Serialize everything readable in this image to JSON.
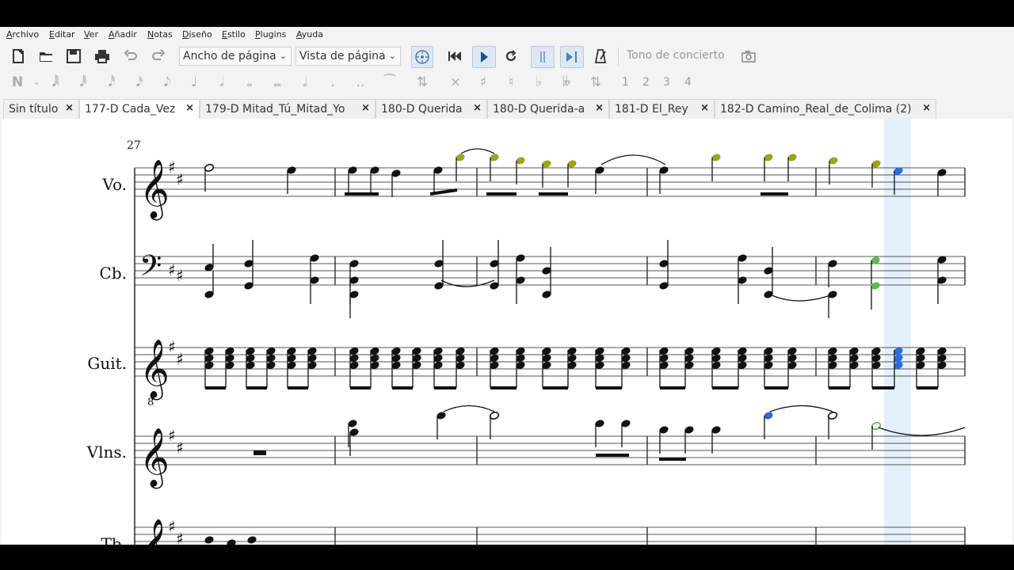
{
  "menu": [
    "Archivo",
    "Editar",
    "Ver",
    "Añadir",
    "Notas",
    "Diseño",
    "Estilo",
    "Plugins",
    "Ayuda"
  ],
  "toolbar": {
    "icons": [
      "new-file-icon",
      "open-folder-icon",
      "save-icon",
      "print-icon",
      "undo-icon",
      "redo-icon"
    ],
    "zoom_select": "Ancho de página",
    "view_select": "Vista de página",
    "playback_icons": [
      "mixer-icon",
      "rewind-icon",
      "play-icon",
      "loop-icon",
      "loop-in-icon",
      "loop-out-icon",
      "metronome-icon"
    ],
    "concert_pitch": "Tono de concierto",
    "camera_icon": "camera-icon"
  },
  "note_input": {
    "durations": [
      "𝅘𝅥𝅲",
      "𝅘𝅥𝅱",
      "𝅘𝅥𝅰",
      "𝅘𝅥𝅯",
      "𝅘𝅥𝅮",
      "♩",
      "𝅗𝅥",
      "𝅝",
      "𝅜",
      "𝅗𝅥"
    ],
    "dots": [
      ".",
      ".."
    ],
    "accidentals": [
      "×",
      "♯",
      "♮",
      "♭",
      "𝄫"
    ],
    "voices": [
      "1",
      "2",
      "3",
      "4"
    ]
  },
  "tabs": [
    {
      "label": "Sin título",
      "close": "×"
    },
    {
      "label": "177-D  Cada_Vez",
      "close": "×"
    },
    {
      "label": "179-D  Mitad_Tú_Mitad_Yo",
      "close": "×"
    },
    {
      "label": "180-D  Querida",
      "close": "×"
    },
    {
      "label": "180-D  Querida-a",
      "close": "×"
    },
    {
      "label": "181-D  El_Rey",
      "close": "×"
    },
    {
      "label": "182-D  Camino_Real_de_Colima (2)",
      "close": "×"
    }
  ],
  "score": {
    "measure_number": "27",
    "instruments": [
      "Vo.",
      "Cb.",
      "Guit.",
      "Vlns.",
      "Tb."
    ],
    "octave_mark": "8",
    "colors": {
      "selected": "#2a6be0",
      "voice3": "#9aa51c",
      "voice_green": "#5cbc4e",
      "cursor": "#d8e9fb"
    }
  }
}
